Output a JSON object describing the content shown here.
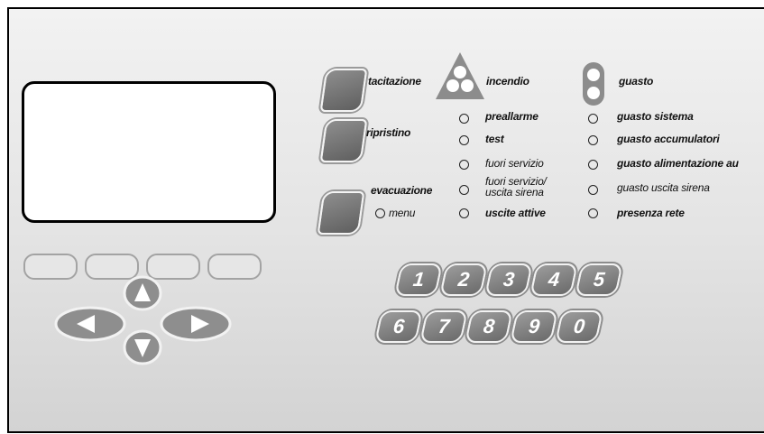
{
  "panel": {
    "buttons": {
      "silence": "tacitazione",
      "reset": "ripristino",
      "evacuation": "evacuazione",
      "menu": "menu"
    },
    "indicators": {
      "fire": "incendio",
      "fault": "guasto",
      "left": [
        "preallarme",
        "test",
        "fuori servizio",
        "fuori servizio/",
        "uscita sirena",
        "uscite attive"
      ],
      "right": [
        "guasto sistema",
        "guasto accumulatori",
        "guasto alimentazione au",
        "guasto uscita sirena",
        "presenza rete"
      ]
    },
    "keypad": {
      "row1": [
        "1",
        "2",
        "3",
        "4",
        "5"
      ],
      "row2": [
        "6",
        "7",
        "8",
        "9",
        "0"
      ]
    },
    "icons": {
      "arrows": [
        "up-arrow-icon",
        "left-arrow-icon",
        "right-arrow-icon",
        "down-arrow-icon"
      ],
      "fire": "fire-indicator-icon",
      "fault": "fault-indicator-icon"
    }
  }
}
